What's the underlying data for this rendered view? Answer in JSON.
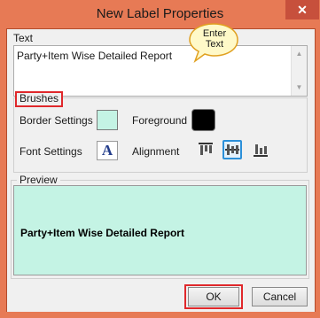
{
  "window": {
    "title": "New Label Properties",
    "close_glyph": "✕",
    "accent_color": "#e77a55"
  },
  "text_section": {
    "label": "Text",
    "value": "Party+Item Wise Detailed Report",
    "callout": "Enter Text"
  },
  "brushes": {
    "label": "Brushes",
    "border_settings_label": "Border Settings",
    "border_color": "#c4f3e4",
    "foreground_label": "Foreground",
    "foreground_color": "#000000",
    "font_settings_label": "Font Settings",
    "font_button_glyph": "A",
    "alignment_label": "Alignment",
    "alignment_options": [
      "align-top-icon",
      "align-center-icon",
      "align-bottom-icon"
    ],
    "alignment_selected": "align-center-icon"
  },
  "preview": {
    "label": "Preview",
    "text": "Party+Item Wise Detailed Report",
    "background": "#c4f3e4"
  },
  "buttons": {
    "ok": "OK",
    "cancel": "Cancel"
  }
}
